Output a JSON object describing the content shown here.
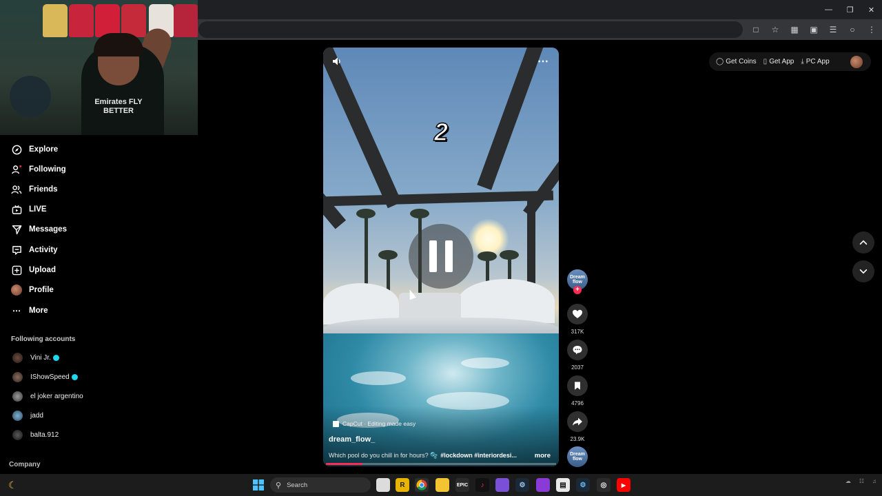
{
  "sidebar": {
    "nav": [
      {
        "label": "Explore",
        "icon": "compass-icon"
      },
      {
        "label": "Following",
        "icon": "user-follow-icon"
      },
      {
        "label": "Friends",
        "icon": "friends-icon"
      },
      {
        "label": "LIVE",
        "icon": "live-tv-icon"
      },
      {
        "label": "Messages",
        "icon": "send-icon"
      },
      {
        "label": "Activity",
        "icon": "activity-icon"
      },
      {
        "label": "Upload",
        "icon": "upload-plus-icon"
      },
      {
        "label": "Profile",
        "icon": "avatar-icon"
      },
      {
        "label": "More",
        "icon": "more-dots-icon"
      }
    ],
    "following_title": "Following accounts",
    "accounts": [
      {
        "name": "Vini Jr.",
        "verified": true
      },
      {
        "name": "IShowSpeed",
        "verified": true
      },
      {
        "name": "el joker argentino",
        "verified": false
      },
      {
        "name": "jadd",
        "verified": false
      },
      {
        "name": "balta.912",
        "verified": false
      }
    ],
    "company": "Company"
  },
  "header": {
    "get_coins": "Get Coins",
    "get_app": "Get App",
    "pc_app": "PC App"
  },
  "webcam": {
    "shirt_text": "Emirates FLY BETTER"
  },
  "video": {
    "overlay_number": "2",
    "capcut": "CapCut · Editing made easy",
    "author": "dream_flow_",
    "caption": "Which pool do you chill in for hours? 🫧",
    "hashtags": "#lockdown #interiordesi...",
    "more": "more",
    "progress": 0.16
  },
  "rail": {
    "avatar_text": "Dream flow",
    "likes": "317K",
    "comments": "2037",
    "saves": "4796",
    "shares": "23.9K"
  },
  "taskbar": {
    "search_placeholder": "Search"
  },
  "colors": {
    "accent": "#fe2c55",
    "verified": "#20d5ec",
    "background": "#000000"
  }
}
